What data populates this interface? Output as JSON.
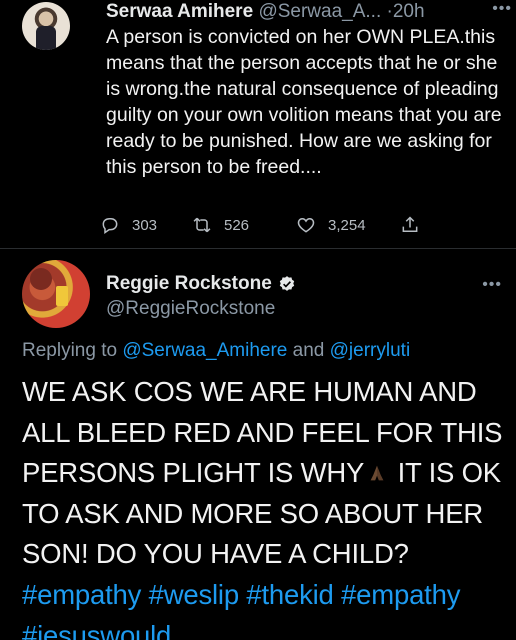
{
  "tweet1": {
    "author_name": "Serwaa Amihere",
    "handle": "@Serwaa_A...",
    "separator": "·",
    "time": "20h",
    "more_icon": "more-horizontal-icon",
    "body": "A person is convicted on her OWN PLEA.this means that the person accepts that he or she is wrong.the natural consequence of pleading guilty on your own volition means that you are ready to be punished. How are we  asking for this person to be freed....",
    "replies": "303",
    "retweets": "526",
    "likes": "3,254"
  },
  "tweet2": {
    "author_name": "Reggie Rockstone",
    "handle": "@ReggieRockstone",
    "verified": true,
    "replying_prefix": "Replying to",
    "replying_to_1": "@Serwaa_Amihere",
    "replying_and": "and",
    "replying_to_2": "@jerryluti",
    "body_part1": "WE ASK COS WE ARE HUMAN AND ALL BLEED RED AND FEEL FOR THIS PERSONS PLIGHT IS WHY",
    "body_emoji": "folded-hands-icon",
    "body_part2": " IT IS OK TO ASK AND MORE SO ABOUT HER SON! DO YOU HAVE A CHILD?",
    "hashtags": "#empathy #weslip #thekid #empathy #jesuswould"
  },
  "colors": {
    "background": "#000000",
    "text": "#e7e9ea",
    "secondary": "#8b98a5",
    "link": "#1d9bf0"
  }
}
